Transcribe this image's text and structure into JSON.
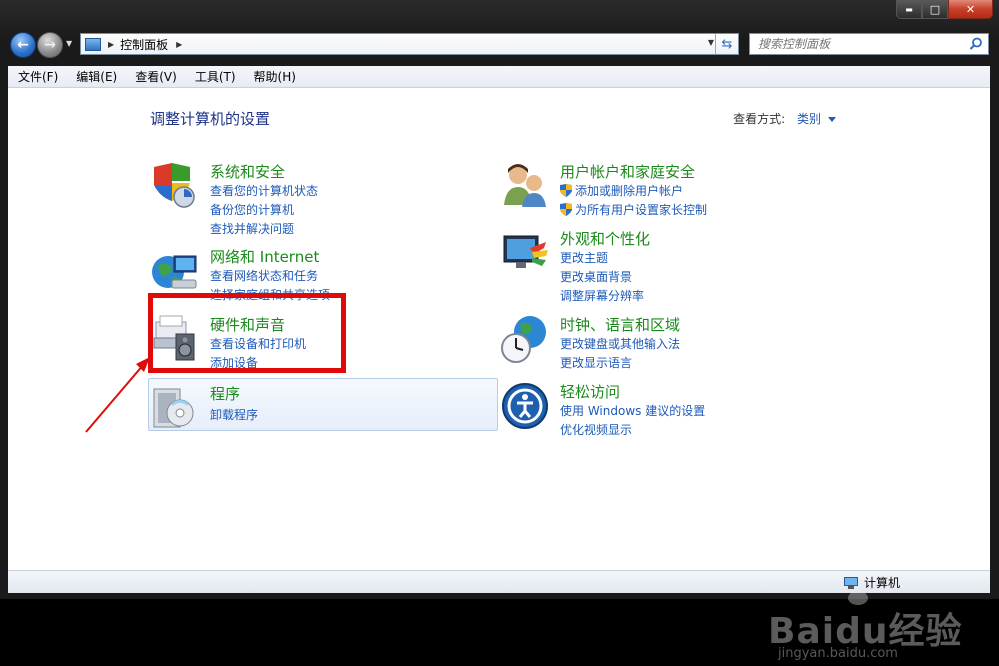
{
  "window": {
    "caption": {
      "min": "▬",
      "max": "□",
      "close": "✕"
    }
  },
  "nav": {
    "back_icon": "back-arrow-icon",
    "forward_icon": "forward-arrow-icon",
    "address": {
      "path": "控制面板"
    },
    "search": {
      "placeholder": "搜索控制面板"
    }
  },
  "menubar": {
    "items": [
      "文件(F)",
      "编辑(E)",
      "查看(V)",
      "工具(T)",
      "帮助(H)"
    ]
  },
  "page": {
    "title": "调整计算机的设置",
    "view_by_label": "查看方式:",
    "view_by_value": "类别"
  },
  "categories": [
    {
      "title": "系统和安全",
      "links": [
        "查看您的计算机状态",
        "备份您的计算机",
        "查找并解决问题"
      ]
    },
    {
      "title": "网络和 Internet",
      "links": [
        "查看网络状态和任务",
        "选择家庭组和共享选项"
      ]
    },
    {
      "title": "硬件和声音",
      "links": [
        "查看设备和打印机",
        "添加设备"
      ]
    },
    {
      "title": "程序",
      "links": [
        "卸载程序"
      ]
    },
    {
      "title": "用户帐户和家庭安全",
      "links": [
        "添加或删除用户帐户",
        "为所有用户设置家长控制"
      ]
    },
    {
      "title": "外观和个性化",
      "links": [
        "更改主题",
        "更改桌面背景",
        "调整屏幕分辨率"
      ]
    },
    {
      "title": "时钟、语言和区域",
      "links": [
        "更改键盘或其他输入法",
        "更改显示语言"
      ]
    },
    {
      "title": "轻松访问",
      "links": [
        "使用 Windows 建议的设置",
        "优化视频显示"
      ]
    }
  ],
  "statusbar": {
    "computer": "计算机"
  },
  "watermark": {
    "brand": "Baidu经验",
    "site": "jingyan.baidu.com"
  },
  "annotation": {
    "color": "#e00a0a"
  }
}
